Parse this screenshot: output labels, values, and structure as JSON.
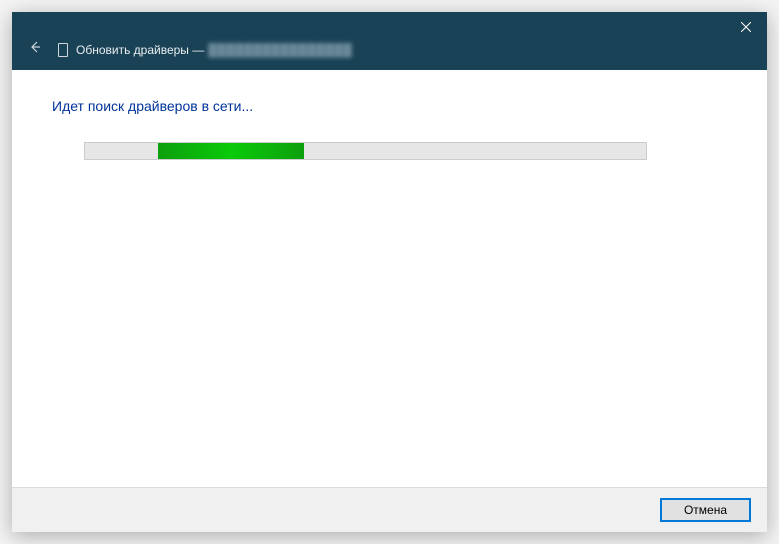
{
  "titlebar": {
    "title_prefix": "Обновить драйверы —",
    "title_device": "████████████████"
  },
  "content": {
    "heading": "Идет поиск драйверов в сети...",
    "progress": {
      "indeterminate": true,
      "chunk_start_percent": 13,
      "chunk_width_percent": 26
    }
  },
  "footer": {
    "cancel_label": "Отмена"
  },
  "colors": {
    "titlebar_bg": "#1a4256",
    "heading_color": "#003399",
    "progress_fill": "#0aca0a",
    "button_focus_border": "#0078d7"
  }
}
